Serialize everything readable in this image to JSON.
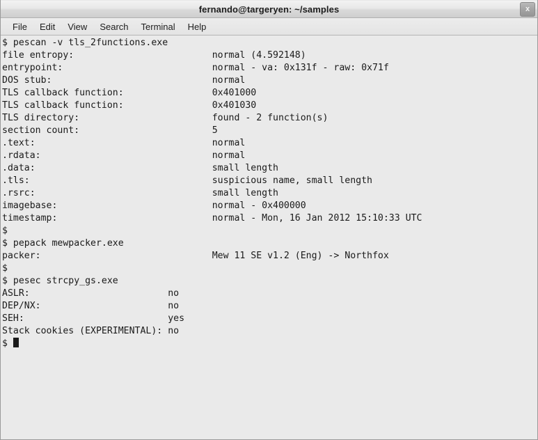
{
  "window": {
    "title": "fernando@targeryen: ~/samples",
    "close_label": "x"
  },
  "menubar": {
    "items": [
      {
        "label": "File"
      },
      {
        "label": "Edit"
      },
      {
        "label": "View"
      },
      {
        "label": "Search"
      },
      {
        "label": "Terminal"
      },
      {
        "label": "Help"
      }
    ]
  },
  "terminal": {
    "prompt": "$",
    "value_column": 38,
    "lines": [
      {
        "type": "command",
        "text": "$ pescan -v tls_2functions.exe"
      },
      {
        "type": "pair",
        "label": "file entropy:",
        "value": "normal (4.592148)"
      },
      {
        "type": "pair",
        "label": "entrypoint:",
        "value": "normal - va: 0x131f - raw: 0x71f"
      },
      {
        "type": "pair",
        "label": "DOS stub:",
        "value": "normal"
      },
      {
        "type": "pair",
        "label": "TLS callback function:",
        "value": "0x401000"
      },
      {
        "type": "pair",
        "label": "TLS callback function:",
        "value": "0x401030"
      },
      {
        "type": "pair",
        "label": "TLS directory:",
        "value": "found - 2 function(s)"
      },
      {
        "type": "pair",
        "label": "section count:",
        "value": "5"
      },
      {
        "type": "pair",
        "label": ".text:",
        "value": "normal"
      },
      {
        "type": "pair",
        "label": ".rdata:",
        "value": "normal"
      },
      {
        "type": "pair",
        "label": ".data:",
        "value": "small length"
      },
      {
        "type": "pair",
        "label": ".tls:",
        "value": "suspicious name, small length"
      },
      {
        "type": "pair",
        "label": ".rsrc:",
        "value": "small length"
      },
      {
        "type": "pair",
        "label": "imagebase:",
        "value": "normal - 0x400000"
      },
      {
        "type": "pair",
        "label": "timestamp:",
        "value": "normal - Mon, 16 Jan 2012 15:10:33 UTC"
      },
      {
        "type": "command",
        "text": "$"
      },
      {
        "type": "command",
        "text": "$ pepack mewpacker.exe"
      },
      {
        "type": "pair",
        "label": "packer:",
        "value": "Mew 11 SE v1.2 (Eng) -> Northfox"
      },
      {
        "type": "command",
        "text": "$"
      },
      {
        "type": "command",
        "text": "$ pesec strcpy_gs.exe"
      },
      {
        "type": "pair",
        "label": "ASLR:",
        "value": "no",
        "pad": 30
      },
      {
        "type": "pair",
        "label": "DEP/NX:",
        "value": "no",
        "pad": 30
      },
      {
        "type": "pair",
        "label": "SEH:",
        "value": "yes",
        "pad": 30
      },
      {
        "type": "pair",
        "label": "Stack cookies (EXPERIMENTAL):",
        "value": "no",
        "pad": 30
      },
      {
        "type": "cursor",
        "text": "$ "
      }
    ]
  },
  "colors": {
    "terminal_background": "#eaeaea",
    "terminal_foreground": "#1a1a1a",
    "titlebar_text": "#1d1d1d",
    "window_border": "#9a9a9a"
  }
}
